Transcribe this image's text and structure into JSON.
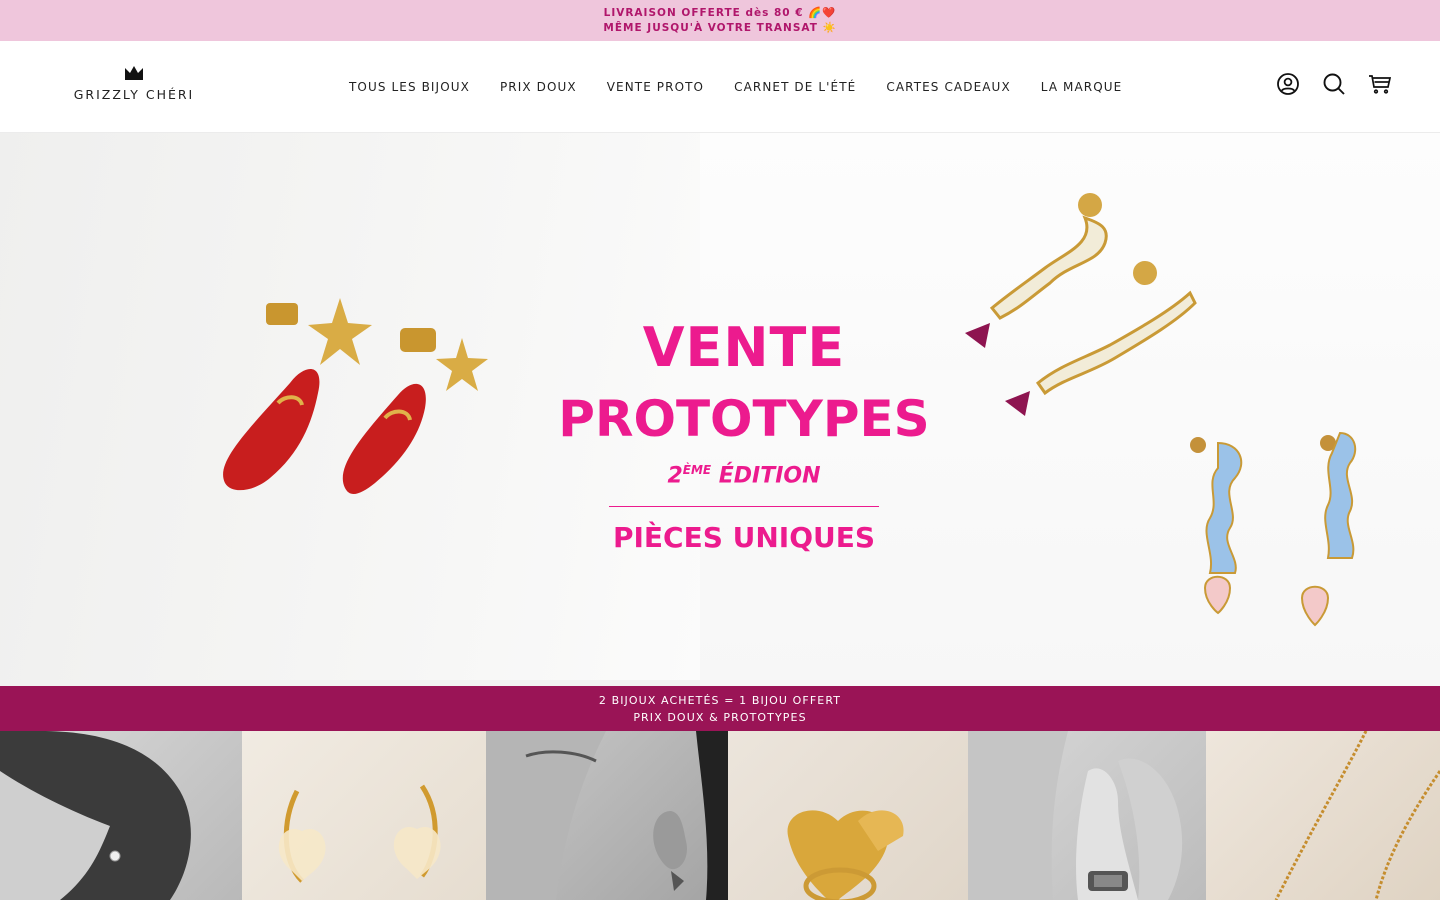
{
  "announcement": {
    "line1": "LIVRAISON OFFERTE dès 80 € 🌈❤️",
    "line2": "MÊME JUSQU'À VOTRE TRANSAT ☀️"
  },
  "header": {
    "logo_text": "GRIZZLY CHÉRI",
    "nav": [
      {
        "label": "TOUS LES BIJOUX"
      },
      {
        "label": "PRIX DOUX"
      },
      {
        "label": "VENTE PROTO"
      },
      {
        "label": "CARNET DE L'ÉTÉ"
      },
      {
        "label": "CARTES CADEAUX"
      },
      {
        "label": "LA MARQUE"
      }
    ],
    "icons": [
      "account-icon",
      "search-icon",
      "cart-icon"
    ]
  },
  "hero": {
    "title_line1": "VENTE",
    "title_line2": "PROTOTYPES",
    "edition_num": "2",
    "edition_sup": "ÈME",
    "edition_text": "ÉDITION",
    "subtitle": "PIÈCES UNIQUES",
    "accent_color": "#ec1b8e"
  },
  "promo": {
    "line1": "2 BIJOUX ACHETÉS = 1 BIJOU OFFERT",
    "line2": "PRIX DOUX & PROTOTYPES",
    "background": "#9a1456"
  },
  "gallery": {
    "tiles": [
      "woman-profile-earring-photo",
      "heart-hoop-earrings-photo",
      "woman-ear-earring-photo",
      "gold-hammered-ring-photo",
      "woman-hand-ring-photo",
      "gold-chain-necklace-photo"
    ]
  }
}
